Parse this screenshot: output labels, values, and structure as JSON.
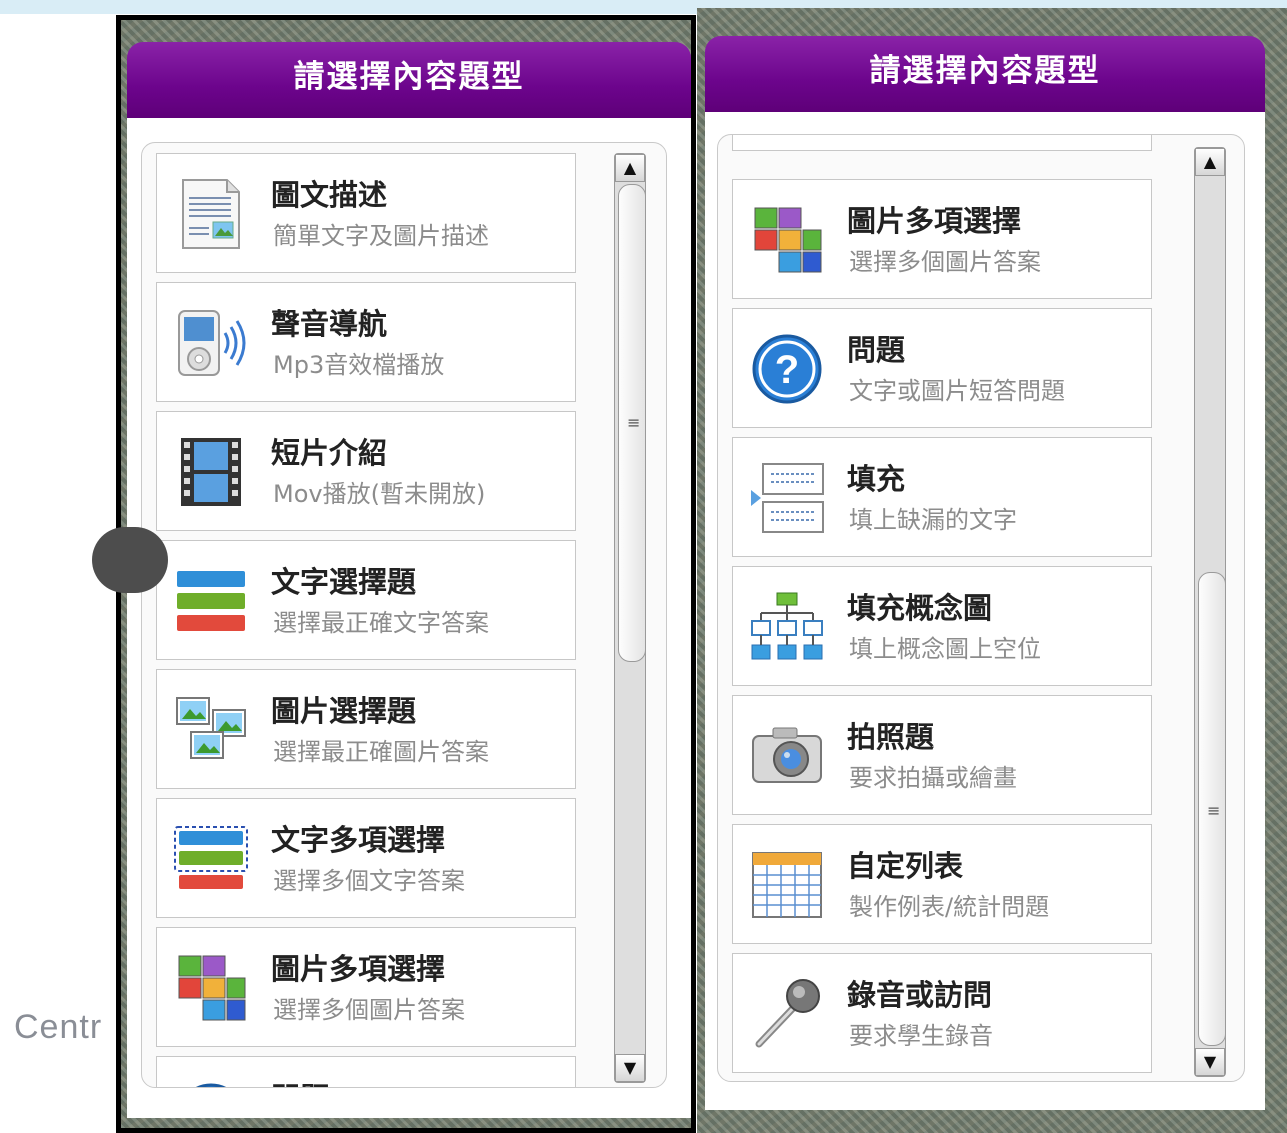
{
  "footer_text": "Centr",
  "left_panel": {
    "header": "請選擇內容題型",
    "items": [
      {
        "title": "圖文描述",
        "subtitle": "簡單文字及圖片描述",
        "icon": "document-image-icon"
      },
      {
        "title": "聲音導航",
        "subtitle": "Mp3音效檔播放",
        "icon": "audio-player-icon"
      },
      {
        "title": "短片介紹",
        "subtitle": "Mov播放(暫未開放)",
        "icon": "film-strip-icon"
      },
      {
        "title": "文字選擇題",
        "subtitle": "選擇最正確文字答案",
        "icon": "text-choice-icon"
      },
      {
        "title": "圖片選擇題",
        "subtitle": "選擇最正確圖片答案",
        "icon": "image-choice-icon"
      },
      {
        "title": "文字多項選擇",
        "subtitle": "選擇多個文字答案",
        "icon": "text-multi-choice-icon"
      },
      {
        "title": "圖片多項選擇",
        "subtitle": "選擇多個圖片答案",
        "icon": "image-multi-choice-icon"
      },
      {
        "title": "問題",
        "subtitle": "",
        "icon": "question-icon"
      }
    ],
    "scroll_fraction": 0.0
  },
  "right_panel": {
    "header": "請選擇內容題型",
    "items": [
      {
        "title": "圖片多項選擇",
        "subtitle": "選擇多個圖片答案",
        "icon": "image-multi-choice-icon"
      },
      {
        "title": "問題",
        "subtitle": "文字或圖片短答問題",
        "icon": "question-icon"
      },
      {
        "title": "填充",
        "subtitle": "填上缺漏的文字",
        "icon": "fill-blank-icon"
      },
      {
        "title": "填充概念圖",
        "subtitle": "填上概念圖上空位",
        "icon": "concept-map-icon"
      },
      {
        "title": "拍照題",
        "subtitle": "要求拍攝或繪畫",
        "icon": "camera-icon"
      },
      {
        "title": "自定列表",
        "subtitle": "製作例表/統計問題",
        "icon": "table-icon"
      },
      {
        "title": "錄音或訪問",
        "subtitle": "要求學生錄音",
        "icon": "microphone-icon"
      }
    ],
    "scroll_fraction": 1.0
  },
  "scrollbar": {
    "up_glyph": "▲",
    "down_glyph": "▼",
    "grip_glyph": "≡"
  }
}
